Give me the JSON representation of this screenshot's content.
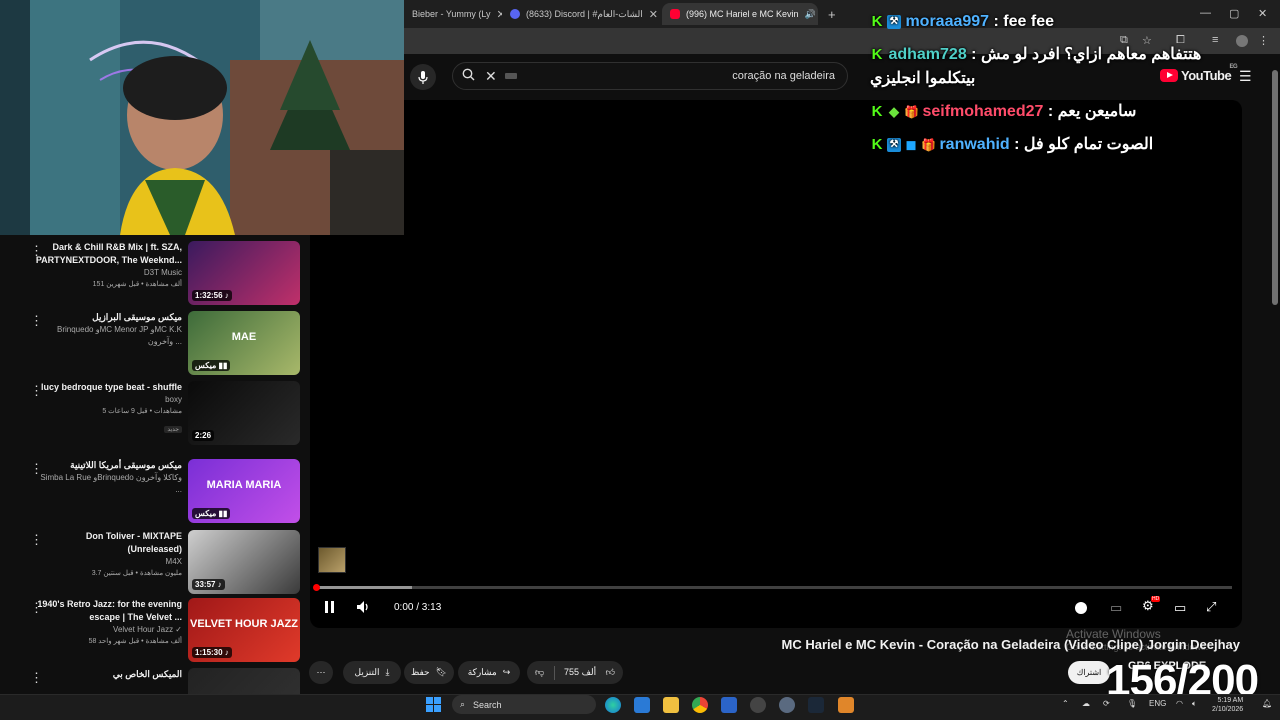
{
  "browser": {
    "tabs": [
      {
        "label": "Bieber - Yummy (Ly",
        "close": "✕",
        "active": false,
        "favicon_color": "#ff0033"
      },
      {
        "label": "(8633) Discord | #الشات-العام",
        "close": "✕",
        "active": false,
        "favicon_color": "#5865f2"
      },
      {
        "label": "(996) MC Hariel e MC Kevin",
        "close": "✕",
        "active": true,
        "favicon_color": "#ff0033"
      }
    ],
    "new_tab": "+",
    "window_controls": [
      "—",
      "▢",
      "✕"
    ]
  },
  "youtube": {
    "search": {
      "value": "coração na geladeira"
    },
    "logo_text": "YouTube",
    "logo_region": "EG"
  },
  "chat": [
    {
      "badges": [
        "K",
        "⚒"
      ],
      "user": "moraaa997",
      "user_color": "#4fb2ff",
      "sep": " : ",
      "message": "fee fee"
    },
    {
      "badges": [
        "K"
      ],
      "user": "adham728",
      "user_color": "#4fd0c8",
      "sep": " : ",
      "message": "هتتفاهم معاهم ازاي؟ افرد لو مش بيتكلموا انجليزي"
    },
    {
      "badges": [
        "K",
        "◆",
        "🎁"
      ],
      "user": "seifmohamed27",
      "user_color": "#ff4c6a",
      "sep": " : ",
      "message": "ساميعن يعم"
    },
    {
      "badges": [
        "K",
        "⚒",
        "◼",
        "🎁"
      ],
      "user": "ranwahid",
      "user_color": "#4fb2ff",
      "sep": " : ",
      "message": "الصوت تمام كلو فل"
    }
  ],
  "player": {
    "time": "0:00 / 3:13",
    "progress_fraction": 0.0,
    "buffered_fraction": 0.105,
    "hd_badge": "HD"
  },
  "video": {
    "title": "MC Hariel e MC Kevin - Coração na Geladeira (Video Clipe) Jorgin Deejhay",
    "likes": "755 ألف",
    "share": "مشاركة",
    "save": "حفظ",
    "download": "التنزيل",
    "subscribe": "اشتراك",
    "channel": "GR6 EXPLODE",
    "activate_line1": "Activate Windows",
    "activate_line2": "Go to Settings to activate Windows.",
    "overlay_counter": "156/200"
  },
  "recommendations": [
    {
      "title": "Dark & Chill R&B Mix | ft. SZA, PARTYNEXTDOOR, The Weeknd...",
      "channel": "D3T Music",
      "meta": "151 ألف مشاهدة • قبل شهرين",
      "tag": "",
      "duration": "1:32:56 ♪",
      "thumb_text": "",
      "thumb_colors": [
        "#3a1a5e",
        "#c0306a"
      ]
    },
    {
      "title": "ميكس موسيقى البرازيل",
      "channel": "Brinquedo وMC Menor JP وMC K.K وآخرون ...",
      "meta": "",
      "tag": "",
      "duration": "ميكس ▮▮",
      "thumb_text": "MAE",
      "thumb_colors": [
        "#3d6b3a",
        "#a8b86a"
      ]
    },
    {
      "title": "lucy bedroque type beat - shuffle",
      "channel": "boxy",
      "meta": "5 مشاهدات • قبل 9 ساعات",
      "tag": "جديد",
      "duration": "2:26",
      "thumb_text": "",
      "thumb_colors": [
        "#0a0a0a",
        "#2a2a2a"
      ]
    },
    {
      "title": "ميكس موسيقى أمريكا اللاتينية",
      "channel": "Simba La Rue وBrinquedo وكاكلا وآخرون ...",
      "meta": "",
      "tag": "",
      "duration": "ميكس ▮▮",
      "thumb_text": "MARIA MARIA",
      "thumb_colors": [
        "#7a2fd6",
        "#c24fe8"
      ]
    },
    {
      "title": "Don Toliver - MIXTAPE (Unreleased)",
      "channel": "M4X",
      "meta": "3.7 مليون مشاهدة • قبل سنتين",
      "tag": "",
      "duration": "33:57 ♪",
      "thumb_text": "",
      "thumb_colors": [
        "#cfcfcf",
        "#3a3a3a"
      ]
    },
    {
      "title": "1940's Retro Jazz: for the evening escape | The Velvet ...",
      "channel": "Velvet Hour Jazz ✓",
      "meta": "58 ألف مشاهدة • قبل شهر واحد",
      "tag": "",
      "duration": "1:15:30 ♪",
      "thumb_text": "VELVET HOUR JAZZ",
      "thumb_colors": [
        "#a01818",
        "#e03a2a"
      ]
    },
    {
      "title": "الميكس الخاص بي",
      "channel": "",
      "meta": "",
      "tag": "",
      "duration": "",
      "thumb_text": "",
      "thumb_colors": [
        "#222222",
        "#333333"
      ]
    }
  ],
  "taskbar": {
    "search_label": "Search",
    "lang": "ENG",
    "time": "5:19 AM",
    "date": "2/10/2026"
  }
}
